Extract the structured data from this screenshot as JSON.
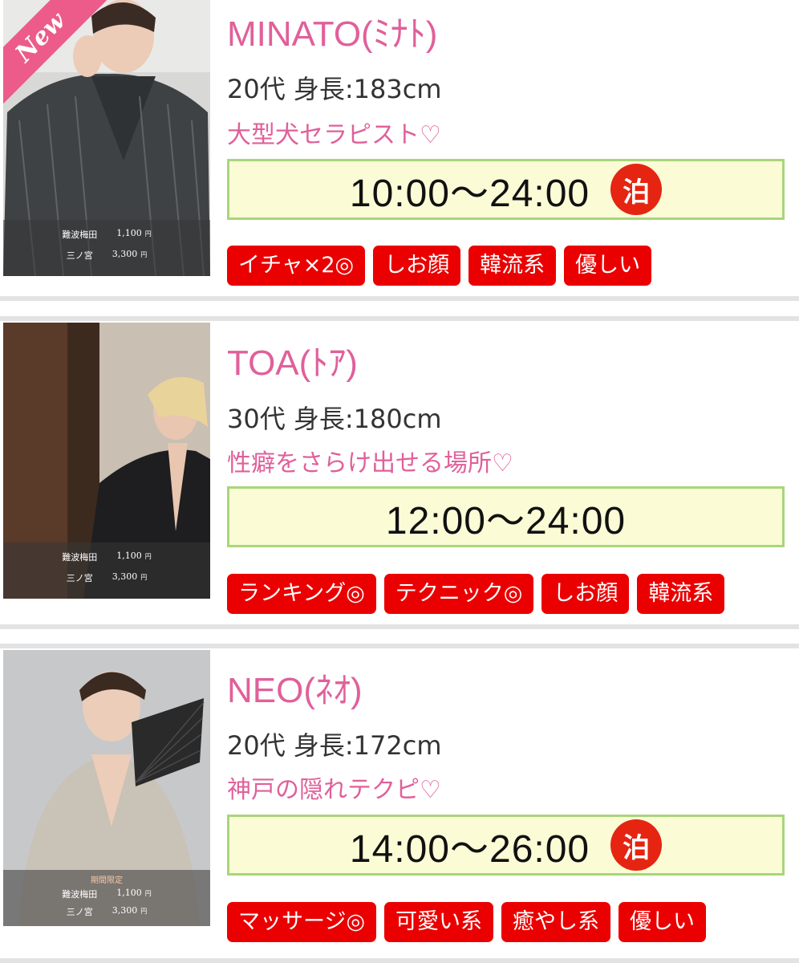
{
  "cast_list": [
    {
      "name": "MINATO(ﾐﾅﾄ)",
      "info": "20代 身長:183cm",
      "catchphrase": "大型犬セラピスト♡",
      "hours": "10:00〜24:00",
      "stay_badge": "泊",
      "is_new": true,
      "new_label": "New",
      "limited_label": "",
      "prices": [
        {
          "area": "難波梅田",
          "price": "1,100",
          "unit": "円"
        },
        {
          "area": "三ノ宮",
          "price": "3,300",
          "unit": "円"
        }
      ],
      "tags": [
        "イチャ×2◎",
        "しお顔",
        "韓流系",
        "優しい"
      ]
    },
    {
      "name": "TOA(ﾄｱ)",
      "info": "30代 身長:180cm",
      "catchphrase": "性癖をさらけ出せる場所♡",
      "hours": "12:00〜24:00",
      "stay_badge": "",
      "is_new": false,
      "new_label": "",
      "limited_label": "",
      "prices": [
        {
          "area": "難波梅田",
          "price": "1,100",
          "unit": "円"
        },
        {
          "area": "三ノ宮",
          "price": "3,300",
          "unit": "円"
        }
      ],
      "tags": [
        "ランキング◎",
        "テクニック◎",
        "しお顔",
        "韓流系"
      ]
    },
    {
      "name": "NEO(ﾈｵ)",
      "info": "20代 身長:172cm",
      "catchphrase": "神戸の隠れテクピ♡",
      "hours": "14:00〜26:00",
      "stay_badge": "泊",
      "is_new": false,
      "new_label": "",
      "limited_label": "期間限定",
      "prices": [
        {
          "area": "難波梅田",
          "price": "1,100",
          "unit": "円"
        },
        {
          "area": "三ノ宮",
          "price": "3,300",
          "unit": "円"
        }
      ],
      "tags": [
        "マッサージ◎",
        "可愛い系",
        "癒やし系",
        "優しい"
      ]
    }
  ],
  "colors": {
    "accent_pink": "#e0609a",
    "tag_red": "#ea0000",
    "hours_bg": "#fbfbd6",
    "hours_border": "#a8d67a",
    "stay_badge_red": "#e52512"
  }
}
